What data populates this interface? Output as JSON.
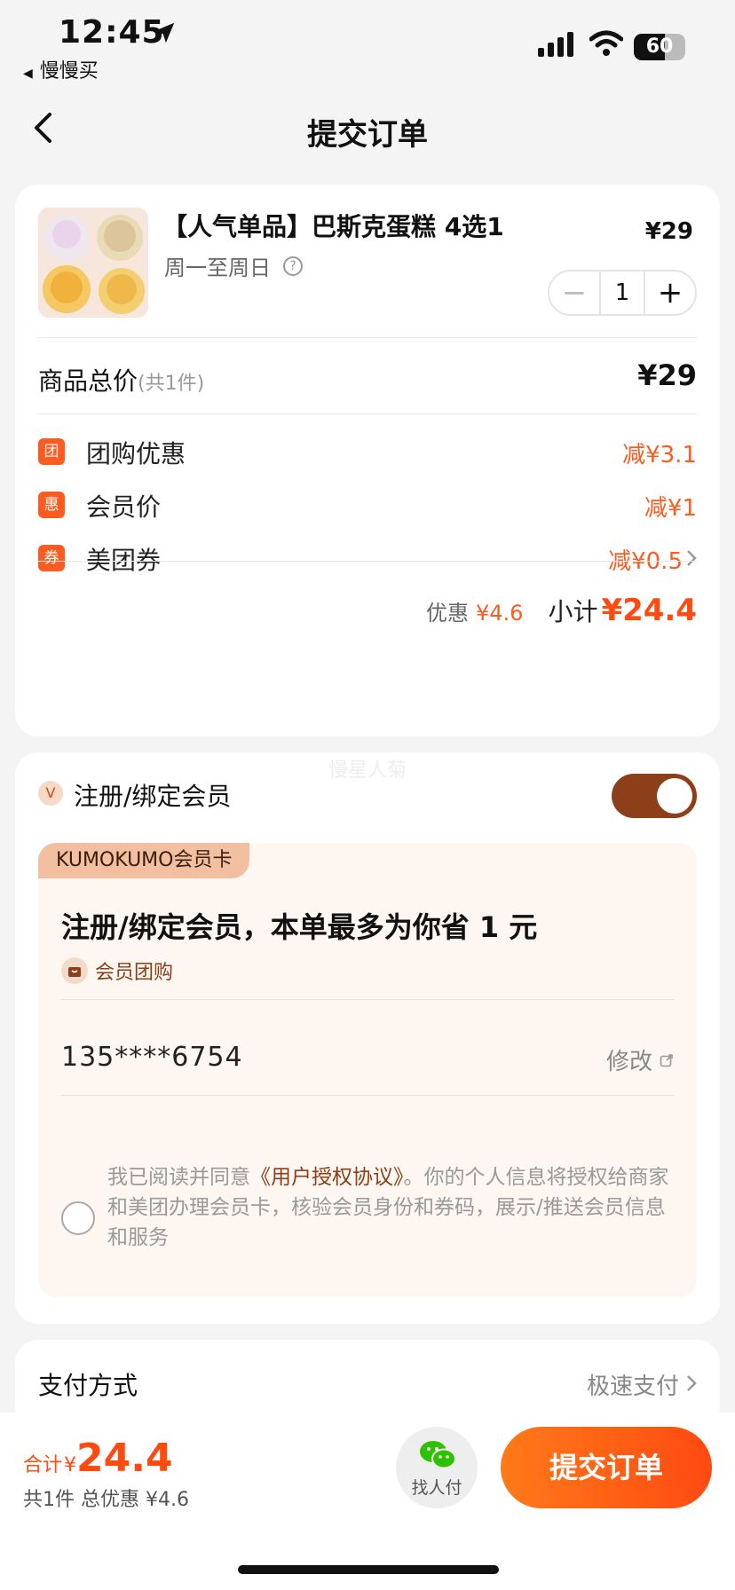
{
  "status_bar": {
    "time": "12:45",
    "back_app": "慢慢买",
    "battery": "60",
    "battery_level": 0.6
  },
  "nav": {
    "title": "提交订单"
  },
  "product": {
    "name": "【人气单品】巴斯克蛋糕 4选1",
    "schedule": "周一至周日",
    "price": "¥29",
    "quantity": "1"
  },
  "totals": {
    "goods_label": "商品总价",
    "goods_count": "(共1件)",
    "goods_total": "¥29"
  },
  "discounts": [
    {
      "badge": "团",
      "label": "团购优惠",
      "value": "减¥3.1"
    },
    {
      "badge": "惠",
      "label": "会员价",
      "value": "减¥1"
    },
    {
      "badge": "券",
      "label": "美团券",
      "value": "减¥0.5"
    }
  ],
  "subtotal": {
    "discount_label": "优惠",
    "discount_value": "¥4.6",
    "subtotal_label": "小计",
    "subtotal_value": "¥24.4"
  },
  "member": {
    "watermark": "慢星人菊",
    "title": "注册/绑定会员",
    "toggle_on": true,
    "card_tag": "KUMOKUMO会员卡",
    "headline": "注册/绑定会员，本单最多为你省 1 元",
    "group_tag": "会员团购",
    "phone": "135****6754",
    "edit_label": "修改",
    "agreement_prefix": "我已阅读并同意",
    "agreement_link": "《用户授权协议》",
    "agreement_text": "。你的个人信息将授权给商家和美团办理会员卡，核验会员身份和券码，展示/推送会员信息和服务"
  },
  "payment": {
    "label": "支付方式",
    "value": "极速支付"
  },
  "bottom_bar": {
    "total_label": "合计",
    "currency": "¥",
    "total_value": "24.4",
    "summary": "共1件  总优惠 ¥4.6",
    "helper_label": "找人付",
    "submit_label": "提交订单"
  },
  "colors": {
    "accent": "#ff4a12",
    "member_brown": "#8c3f18",
    "background": "#f4f4f4"
  },
  "icons": [
    "location-arrow-icon",
    "cellular-signal-icon",
    "wifi-icon",
    "battery-icon",
    "back-chevron-icon",
    "help-icon",
    "minus-icon",
    "plus-icon",
    "chevron-right-icon",
    "member-v-icon",
    "gift-bag-icon",
    "external-link-icon",
    "wechat-icon"
  ]
}
